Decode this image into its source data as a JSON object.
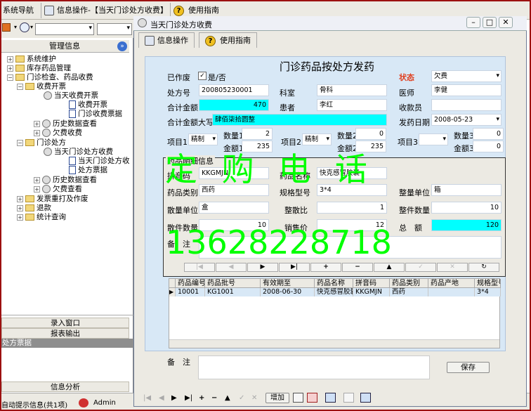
{
  "topbar": {
    "nav_tab": "系统导航",
    "info_tab": "信息操作-【当天门诊处方收费】",
    "guide_tab": "使用指南"
  },
  "left": {
    "title": "管理信息",
    "tree": [
      "系统维护",
      "库存药品管理",
      "门诊检查、药品收费",
      "收费开票",
      "当天收费开票",
      "收费开票",
      "门诊收费票据",
      "历史数据查看",
      "欠费收费",
      "门诊处方",
      "当天门诊处方收费",
      "当天门诊处方收",
      "处方票据",
      "历史数据查看",
      "欠费查看",
      "发票重打及作废",
      "退款",
      "统计查询"
    ],
    "btn_input": "录入窗口",
    "btn_report": "报表输出",
    "selected_item": "处方票据",
    "btn_analysis": "信息分析"
  },
  "status": {
    "text": "自动提示信息(共1项)",
    "user": "Admin"
  },
  "window": {
    "title": "当天门诊处方收费",
    "tab_info": "信息操作",
    "tab_guide": "使用指南"
  },
  "form": {
    "heading": "门诊药品按处方发药",
    "lbl_void": "已作废",
    "chk_void": "是/否",
    "lbl_status": "状态",
    "status_value": "欠费",
    "lbl_rx": "处方号",
    "rx_value": "200805230001",
    "lbl_dept": "科室",
    "dept_value": "骨科",
    "lbl_doctor": "医师",
    "doctor_value": "李健",
    "lbl_total": "合计金额",
    "total_value": "470",
    "lbl_patient": "患者",
    "patient_value": "李红",
    "lbl_cashier": "收款员",
    "cashier_value": "",
    "lbl_total_cn": "合计金额大写",
    "total_cn_value": "肆佰柒拾圆整",
    "lbl_date": "发药日期",
    "date_value": "2008-05-23",
    "lbl_item1": "项目1",
    "item1_value": "精制",
    "lbl_qty1": "数量1",
    "qty1_value": "2",
    "lbl_amt1": "金额1",
    "amt1_value": "235",
    "lbl_item2": "项目2",
    "item2_value": "精制",
    "lbl_qty2": "数量2",
    "qty2_value": "0",
    "lbl_amt2": "金额2",
    "amt2_value": "235",
    "lbl_item3": "项目3",
    "item3_value": "",
    "lbl_qty3": "数量3",
    "qty3_value": "0",
    "lbl_amt3": "金额3",
    "amt3_value": "0",
    "lbl_remark": "备　注",
    "remark_value": "",
    "save": "保存"
  },
  "popup": {
    "title": "药品明细信息",
    "lbl_pinyin": "拼音码",
    "pinyin_value": "KKGMJN",
    "lbl_drugname": "药品名称",
    "drugname_value": "快克感冒胶囊",
    "lbl_cat": "药品类别",
    "cat_value": "西药",
    "lbl_spec": "规格型号",
    "spec_value": "3*4",
    "lbl_unit": "整量单位",
    "unit_value": "箱",
    "lbl_lunit": "散量单位",
    "lunit_value": "盒",
    "lbl_ratio": "整散比",
    "ratio_value": "1",
    "lbl_wqty": "整件数量",
    "wqty_value": "10",
    "lbl_lqty": "散件数量",
    "lqty_value": "10",
    "lbl_price": "销售价",
    "price_value": "12",
    "lbl_sum": "总　额",
    "sum_value": "120",
    "lbl_remark": "备　注",
    "remark_value": ""
  },
  "grid": {
    "headers": [
      "药品编号",
      "药品批号",
      "有效期至",
      "药品名称",
      "拼音码",
      "药品类别",
      "药品产地",
      "规格型号"
    ],
    "row": [
      "10001",
      "KG1001",
      "2008-06-30",
      "快克感冒胶囊",
      "KKGMJN",
      "西药",
      "",
      "3*4"
    ]
  },
  "bottom": {
    "add": "增加"
  },
  "watermark": {
    "line1": "定 购 电 话",
    "line2": "13628228718"
  }
}
